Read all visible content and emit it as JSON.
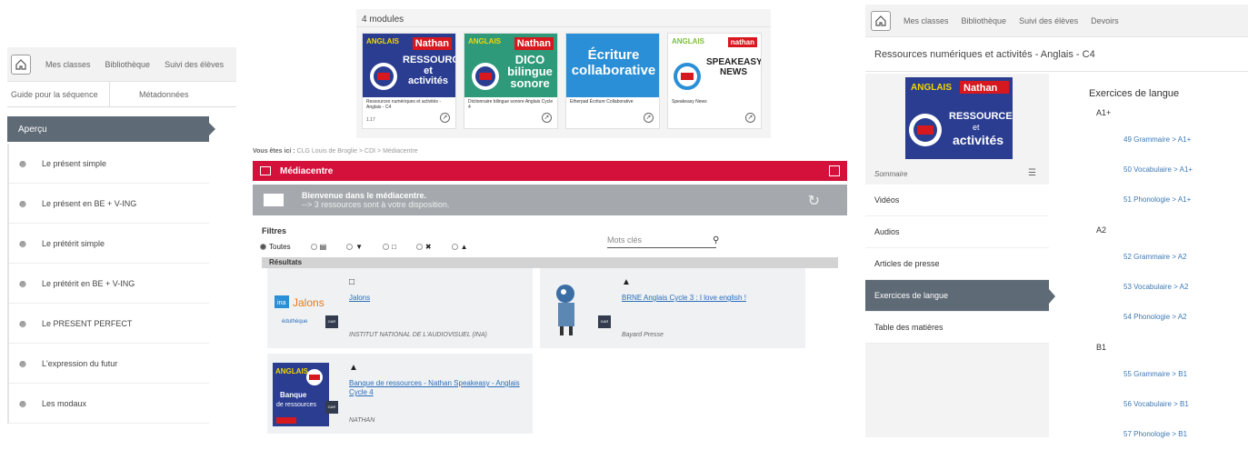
{
  "panel1": {
    "nav": [
      "Mes classes",
      "Bibliothèque",
      "Suivi des élèves"
    ],
    "subtabs": [
      "Guide pour la séquence",
      "Métadonnées"
    ],
    "apercu": "Aperçu",
    "items": [
      "Le présent simple",
      "Le présent en BE + V-ING",
      "Le prétérit simple",
      "Le prétérit en BE + V-ING",
      "Le PRESENT PERFECT",
      "L'expression du futur",
      "Les modaux"
    ]
  },
  "panel2": {
    "header": "4 modules",
    "cards": [
      {
        "ang": "ANGLAIS",
        "brand": "Nathan",
        "title": "RESSOURCES et activités",
        "caption": "Ressources numériques et activités - Anglais - C4",
        "pages": "1.17"
      },
      {
        "ang": "ANGLAIS",
        "brand": "Nathan",
        "title": "DICO bilingue sonore",
        "caption": "Dictionnaire bilingue sonore Anglais Cycle 4",
        "pages": ""
      },
      {
        "ang": "",
        "brand": "",
        "title": "Écriture collaborative",
        "caption": "Etherpad Écriture Collaborative",
        "pages": ""
      },
      {
        "ang": "ANGLAIS",
        "brand": "nathan",
        "title": "SPEAKEASY NEWS",
        "caption": "Speakeasy News",
        "pages": ""
      }
    ]
  },
  "panel3": {
    "crumb_label": "Vous êtes ici :",
    "crumb": "CLG Louis de Broglie > CDI > Médiacentre",
    "bar_title": "Médiacentre",
    "welcome_title": "Bienvenue dans le médiacentre.",
    "welcome_sub": "--> 3 ressources sont à votre disposition.",
    "filters_label": "Filtres",
    "filter_all": "Toutes",
    "search_placeholder": "Mots clés",
    "results_label": "Résultats",
    "results": [
      {
        "title": "Jalons",
        "publisher": "INSTITUT NATIONAL DE L'AUDIOVISUEL (INA)",
        "gar": "GAR"
      },
      {
        "title": "BRNE Anglais Cycle 3 : I love english !",
        "publisher": "Bayard Presse",
        "gar": "GAR"
      },
      {
        "title": "Banque de ressources - Nathan Speakeasy - Anglais Cycle 4",
        "publisher": "NATHAN",
        "gar": "GAR"
      }
    ]
  },
  "panel4": {
    "nav": [
      "Mes classes",
      "Bibliothèque",
      "Suivi des élèves",
      "Devoirs"
    ],
    "title": "Ressources numériques et activités - Anglais - C4",
    "sommaire": "Sommaire",
    "menu": [
      "Vidéos",
      "Audios",
      "Articles de presse",
      "Exercices de langue",
      "Table des matières"
    ],
    "heading": "Exercices de langue",
    "levels": [
      {
        "name": "A1+",
        "items": [
          "49  Grammaire > A1+",
          "50  Vocabulaire > A1+",
          "51  Phonologie > A1+"
        ]
      },
      {
        "name": "A2",
        "items": [
          "52  Grammaire > A2",
          "53  Vocabulaire > A2",
          "54  Phonologie > A2"
        ]
      },
      {
        "name": "B1",
        "items": [
          "55  Grammaire > B1",
          "56  Vocabulaire > B1",
          "57  Phonologie > B1"
        ]
      }
    ]
  },
  "colors": {
    "accent_red": "#d4113b",
    "nav_slate": "#5e6a75",
    "link_blue": "#2a6ebb"
  }
}
